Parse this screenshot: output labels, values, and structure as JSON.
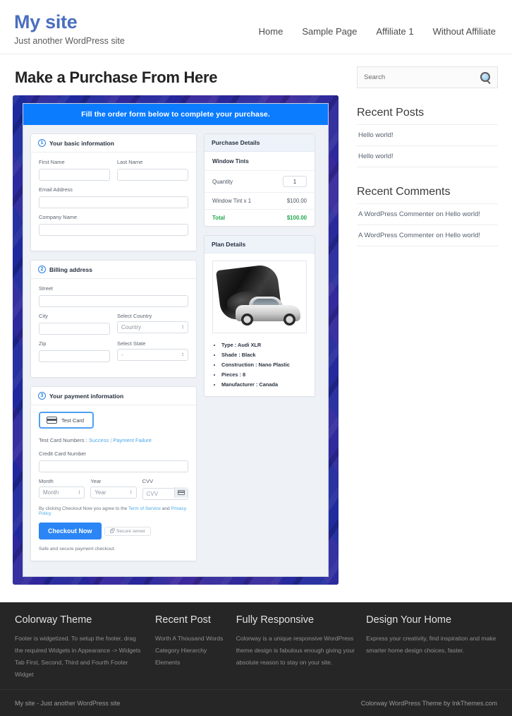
{
  "header": {
    "site_title": "My site",
    "tagline": "Just another WordPress site",
    "nav": [
      {
        "label": "Home"
      },
      {
        "label": "Sample Page"
      },
      {
        "label": "Affiliate 1"
      },
      {
        "label": "Without Affiliate"
      }
    ]
  },
  "main": {
    "page_title": "Make a Purchase From Here",
    "banner": "Fill the order form below to complete your purchase.",
    "basic": {
      "step": "1",
      "heading": "Your basic information",
      "first_name_label": "First Name",
      "first_name_value": "",
      "last_name_label": "Last Name",
      "last_name_value": "",
      "email_label": "Email Address",
      "email_value": "",
      "company_label": "Company Name",
      "company_value": ""
    },
    "billing": {
      "step": "2",
      "heading": "Billing address",
      "street_label": "Street",
      "street_value": "",
      "city_label": "City",
      "city_value": "",
      "country_label": "Select Country",
      "country_value": "Country",
      "zip_label": "Zip",
      "zip_value": "",
      "state_label": "Select State",
      "state_value": "-"
    },
    "payment": {
      "step": "3",
      "heading": "Your payment information",
      "test_card_button": "Test Card",
      "test_numbers_prefix": "Test Card Numbers : ",
      "test_success": "Success",
      "test_separator": " | ",
      "test_failure": "Payment Failure",
      "ccnum_label": "Credit Card Number",
      "ccnum_value": "",
      "month_label": "Month",
      "month_value": "Month",
      "year_label": "Year",
      "year_value": "Year",
      "cvv_label": "CVV",
      "cvv_value": "CVV",
      "terms_prefix": "By clicking Checkout Now you agree to the ",
      "terms_link1": "Term of Service",
      "terms_middle": " and ",
      "terms_link2": "Privacy Policy",
      "checkout_button": "Checkout Now",
      "secure_badge": "Secure server",
      "safe_note": "Safe and secure payment checkout."
    },
    "purchase_details": {
      "title": "Purchase Details",
      "product": "Window Tints",
      "quantity_label": "Quantity",
      "quantity_value": "1",
      "line_item_label": "Window Tint x 1",
      "line_item_price": "$100.00",
      "total_label": "Total",
      "total_price": "$100.00",
      "total_color": "#1fa64a"
    },
    "plan_details": {
      "title": "Plan Details",
      "specs": [
        "Type : Audi XLR",
        "Shade : Black",
        "Construction : Nano Plastic",
        "Pieces : 8",
        "Manufacturer : Canada"
      ]
    }
  },
  "sidebar": {
    "search_placeholder": "Search",
    "search_value": "",
    "recent_posts_title": "Recent Posts",
    "recent_posts": [
      {
        "label": "Hello world!"
      },
      {
        "label": "Hello world!"
      }
    ],
    "recent_comments_title": "Recent Comments",
    "recent_comments": [
      {
        "label": "A WordPress Commenter on Hello world!"
      },
      {
        "label": "A WordPress Commenter on Hello world!"
      }
    ]
  },
  "footer": {
    "columns": [
      {
        "title": "Colorway Theme",
        "text": "Footer is widgetized. To setup the footer, drag the required Widgets in Appearance -> Widgets Tab First, Second, Third and Fourth Footer Widget"
      },
      {
        "title": "Recent Post",
        "items": [
          {
            "label": "Worth A Thousand Words"
          },
          {
            "label": "Category Hierarchy"
          },
          {
            "label": "Elements"
          }
        ]
      },
      {
        "title": "Fully Responsive",
        "text": "Colorway is a unique responsive WordPress theme design is fabulous enough giving your absolute reason to stay on your site."
      },
      {
        "title": "Design Your Home",
        "text": "Express your creativity, find inspiration and make smarter home design choices, faster."
      }
    ],
    "copyright_left": "My site - Just another WordPress site",
    "copyright_right": "Colorway WordPress Theme by InkThemes.com"
  }
}
